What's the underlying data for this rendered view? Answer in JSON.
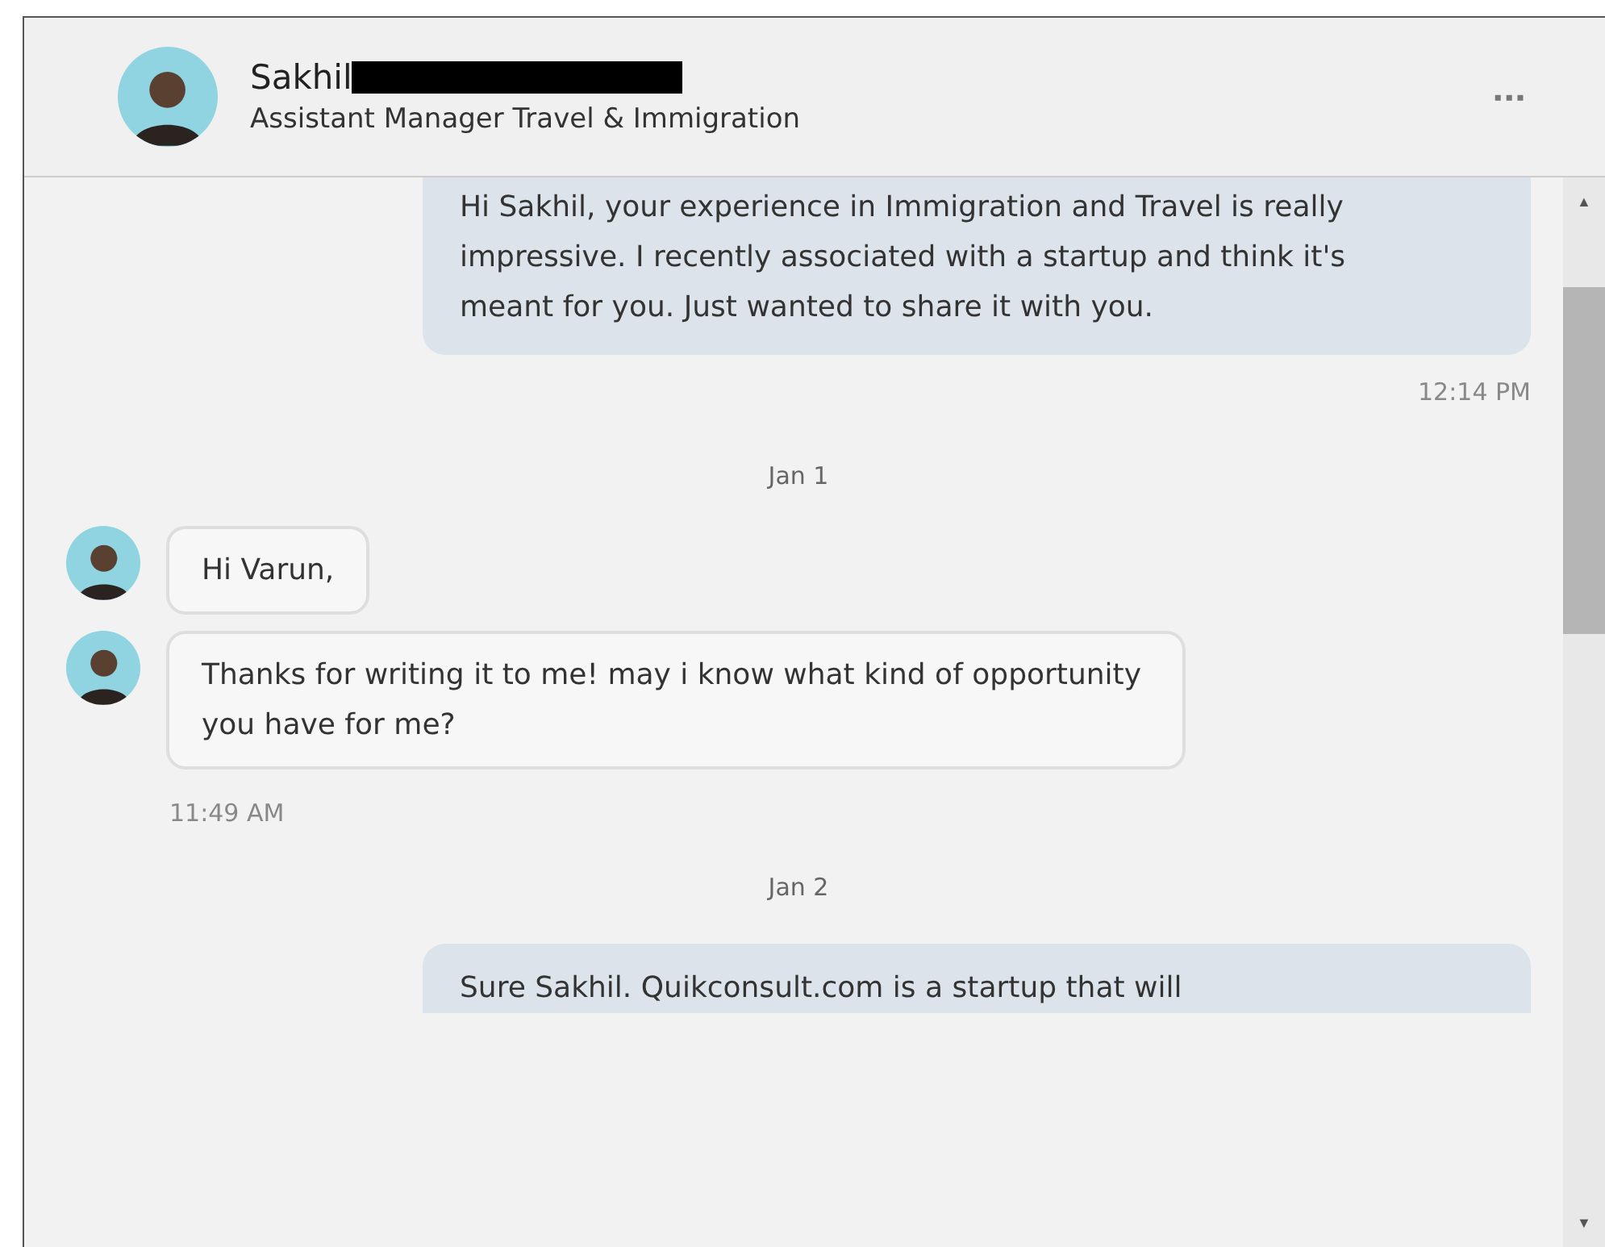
{
  "header": {
    "name": "Sakhil",
    "subtitle": "Assistant Manager Travel & Immigration",
    "menu": "▪▪▪"
  },
  "messages": [
    {
      "kind": "sent",
      "text": "Hi Sakhil, your experience in Immigration and Travel is really impressive. I recently associated with a startup and think it's meant for you. Just wanted to share it with you."
    },
    {
      "kind": "time_right",
      "text": "12:14 PM"
    },
    {
      "kind": "date",
      "text": "Jan 1"
    },
    {
      "kind": "received",
      "text": "Hi Varun,"
    },
    {
      "kind": "received",
      "text": "Thanks for writing it to me! may i know what kind of opportunity you have for me?"
    },
    {
      "kind": "time_left",
      "text": "11:49 AM"
    },
    {
      "kind": "date",
      "text": "Jan 2"
    },
    {
      "kind": "sent_cut",
      "text": "Sure Sakhil. Quikconsult.com is a startup that will"
    }
  ],
  "scrollbar": {
    "up": "▲",
    "down": "▼"
  }
}
